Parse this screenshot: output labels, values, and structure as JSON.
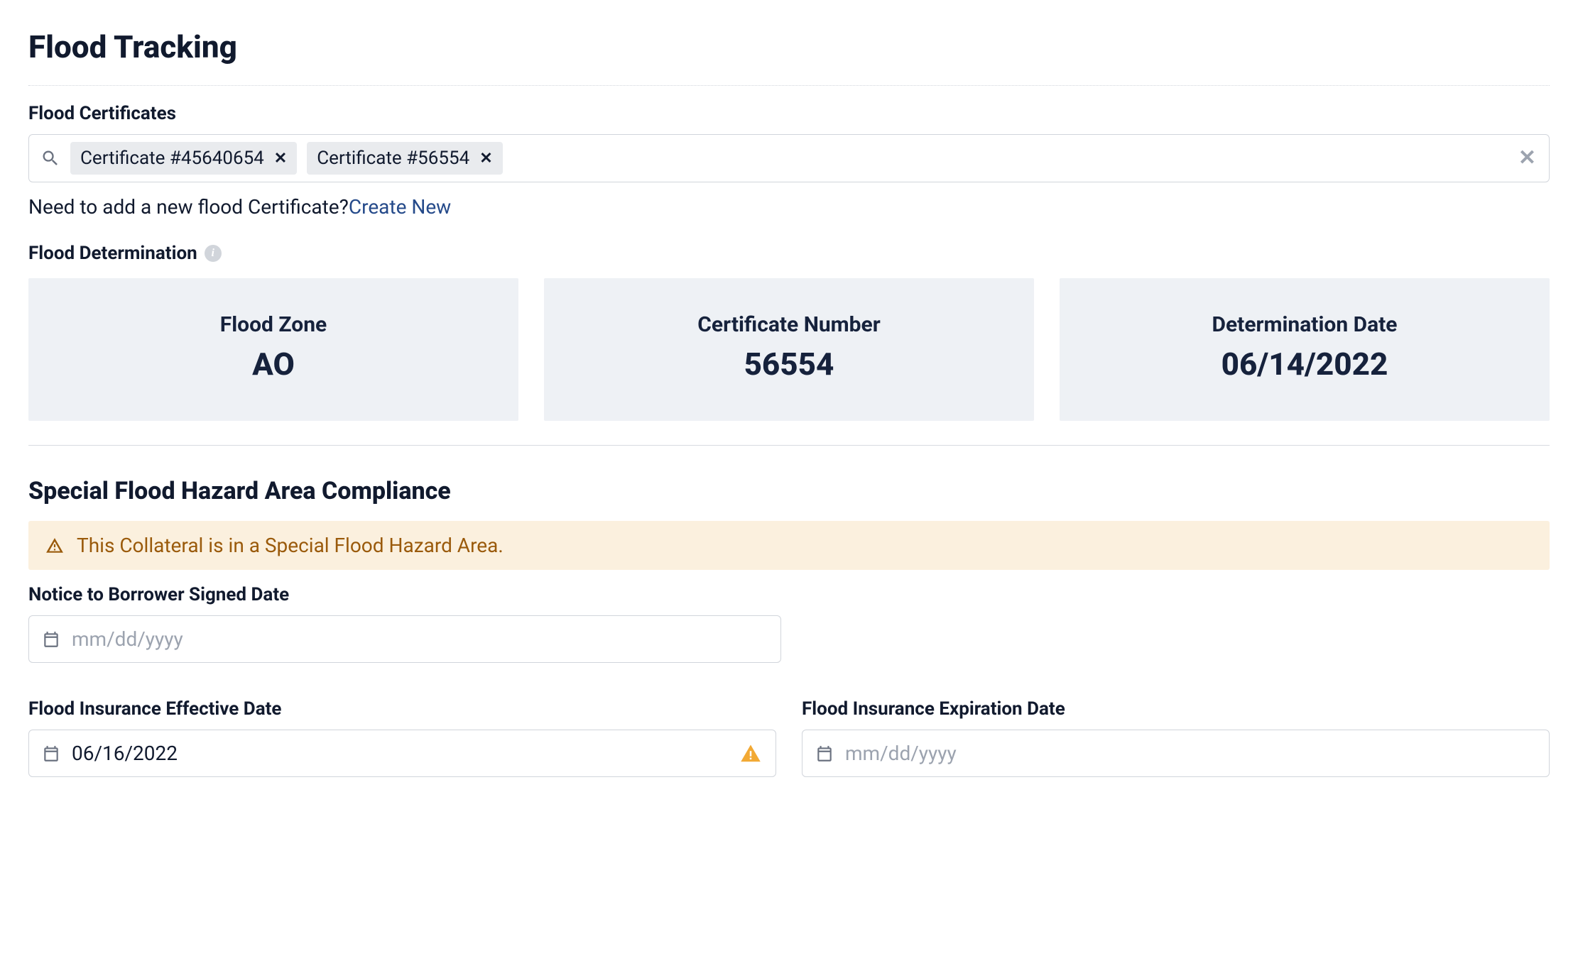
{
  "page": {
    "title": "Flood Tracking"
  },
  "certificates": {
    "label": "Flood Certificates",
    "chips": [
      {
        "label": "Certificate #45640654"
      },
      {
        "label": "Certificate #56554"
      }
    ],
    "helper_prefix": "Need to add a new flood Certificate?",
    "helper_link": "Create New"
  },
  "determination": {
    "label": "Flood Determination",
    "cards": [
      {
        "label": "Flood Zone",
        "value": "AO"
      },
      {
        "label": "Certificate Number",
        "value": "56554"
      },
      {
        "label": "Determination Date",
        "value": "06/14/2022"
      }
    ]
  },
  "compliance": {
    "heading": "Special Flood Hazard Area Compliance",
    "alert_text": "This Collateral is in a Special Flood Hazard Area.",
    "notice_label": "Notice to Borrower Signed Date",
    "notice_placeholder": "mm/dd/yyyy",
    "effective_label": "Flood Insurance Effective Date",
    "effective_value": "06/16/2022",
    "expiration_label": "Flood Insurance Expiration Date",
    "expiration_placeholder": "mm/dd/yyyy"
  }
}
